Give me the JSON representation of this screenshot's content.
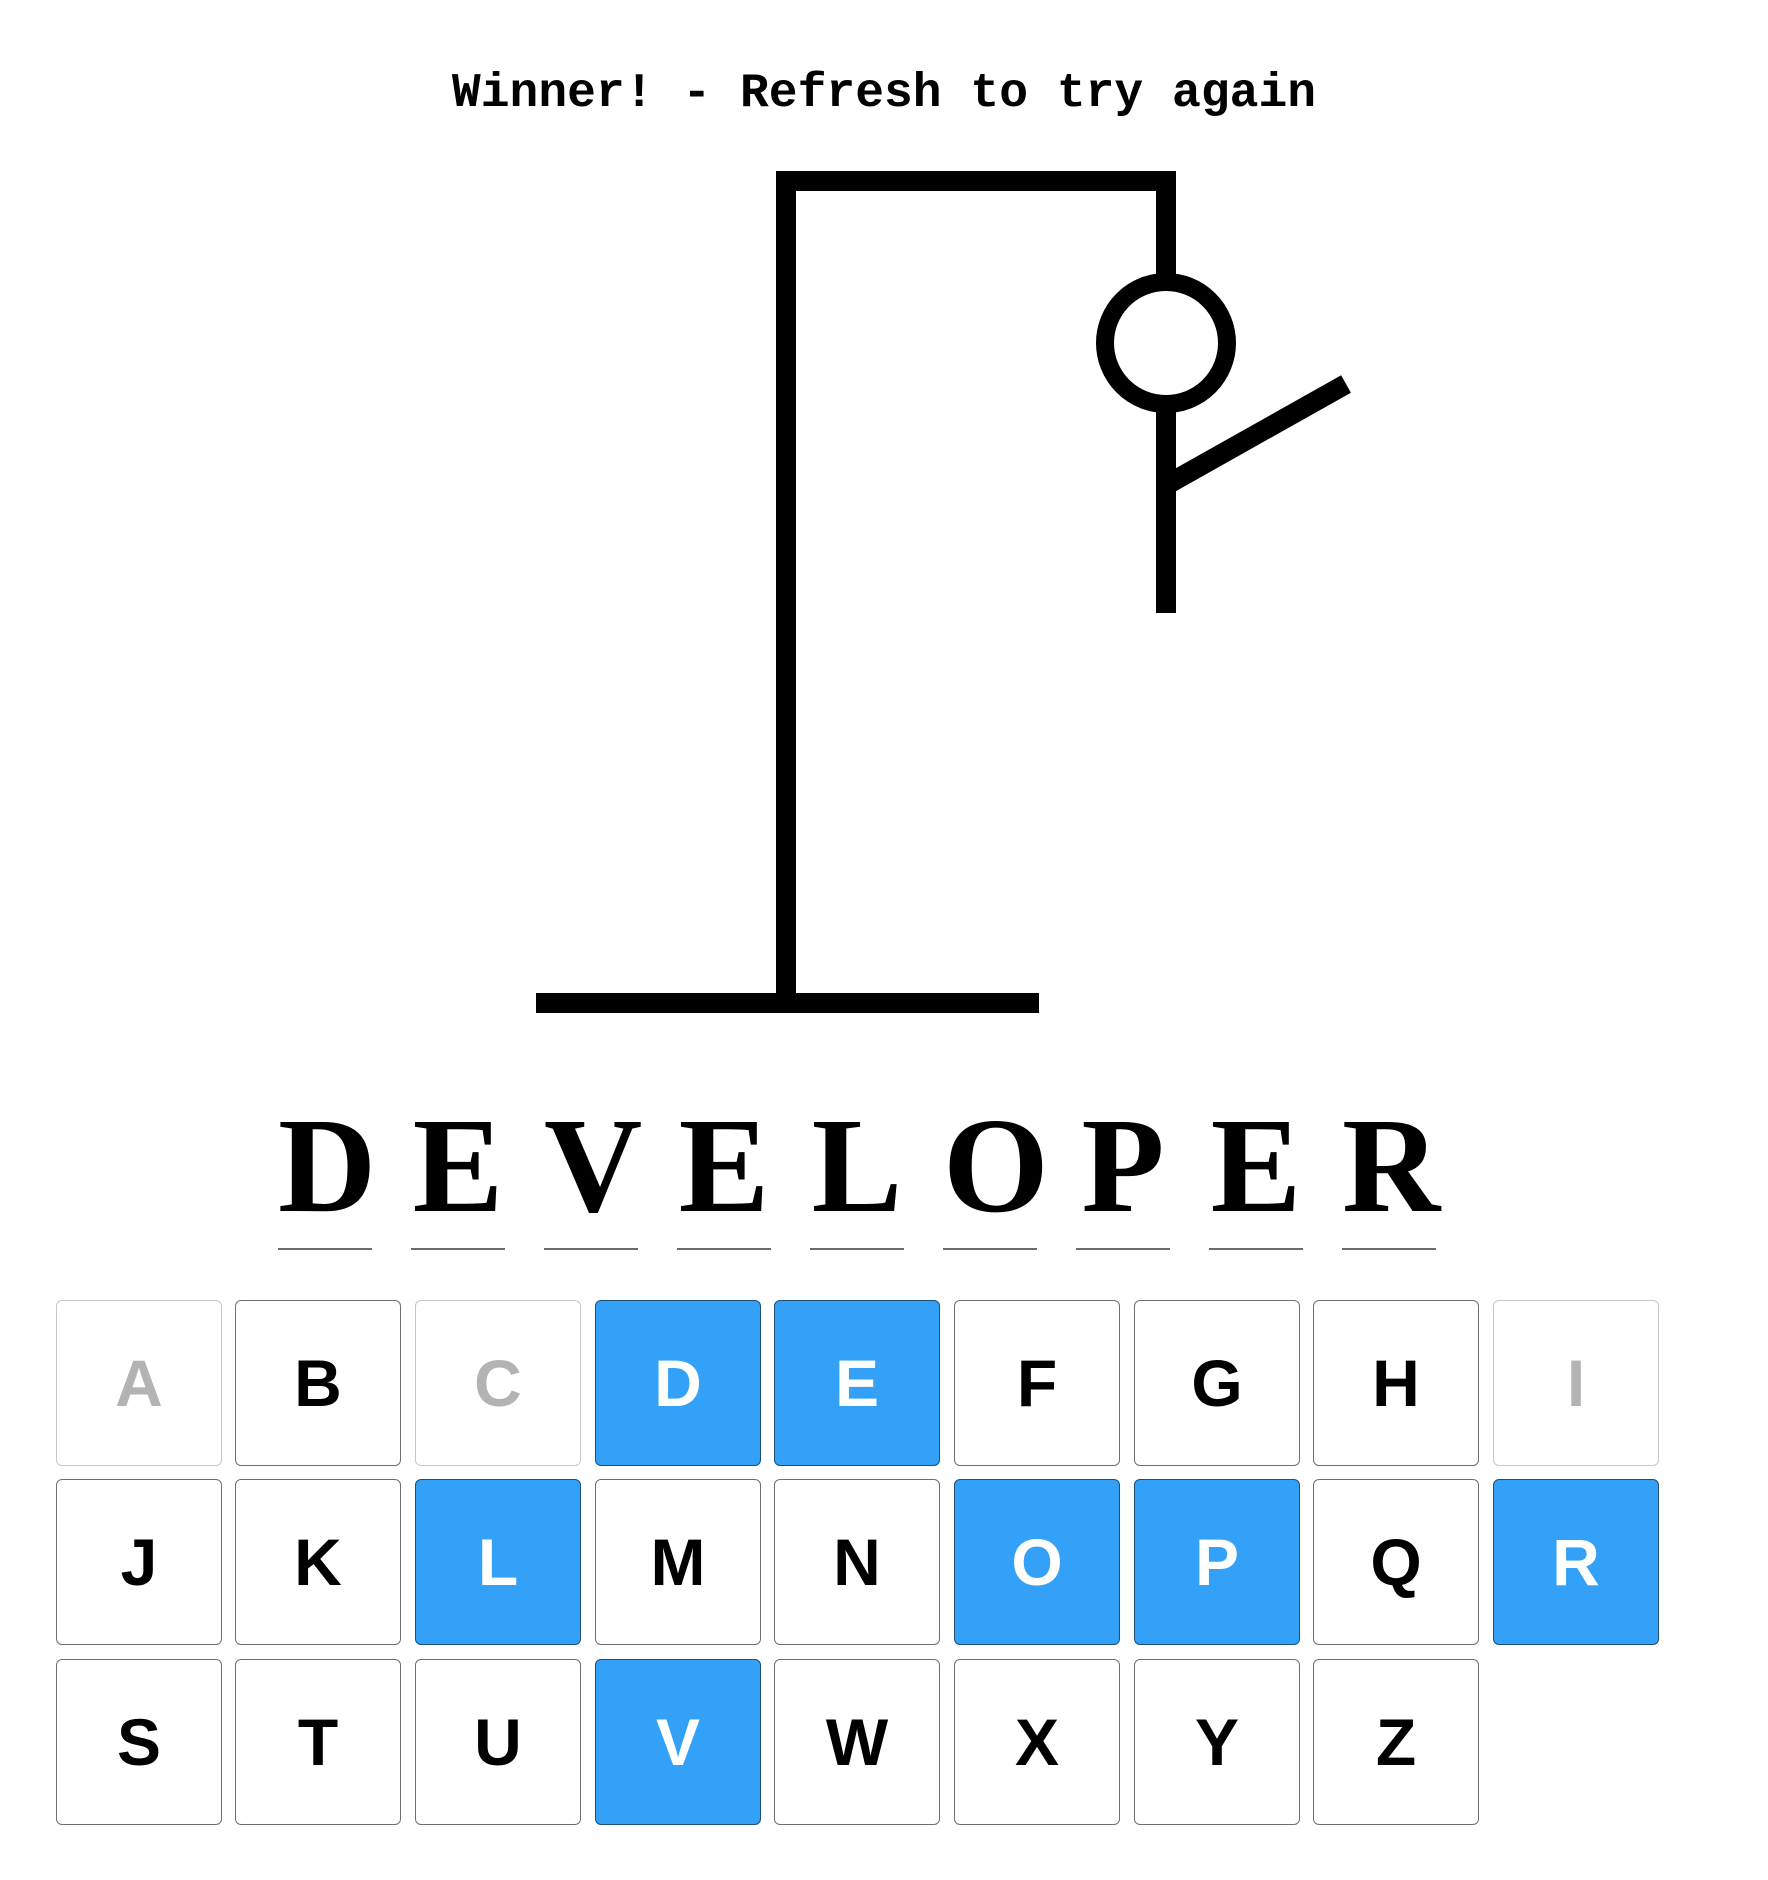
{
  "status": {
    "message": "Winner! - Refresh to try again"
  },
  "hangman": {
    "parts_drawn": [
      "head",
      "body",
      "right-arm"
    ],
    "stroke_color": "#000000"
  },
  "word": {
    "letters": [
      "D",
      "E",
      "V",
      "E",
      "L",
      "O",
      "P",
      "E",
      "R"
    ]
  },
  "keyboard": {
    "keys": [
      {
        "letter": "A",
        "state": "wrong"
      },
      {
        "letter": "B",
        "state": "unused"
      },
      {
        "letter": "C",
        "state": "wrong"
      },
      {
        "letter": "D",
        "state": "correct"
      },
      {
        "letter": "E",
        "state": "correct"
      },
      {
        "letter": "F",
        "state": "unused"
      },
      {
        "letter": "G",
        "state": "unused"
      },
      {
        "letter": "H",
        "state": "unused"
      },
      {
        "letter": "I",
        "state": "wrong"
      },
      {
        "letter": "J",
        "state": "unused"
      },
      {
        "letter": "K",
        "state": "unused"
      },
      {
        "letter": "L",
        "state": "correct"
      },
      {
        "letter": "M",
        "state": "unused"
      },
      {
        "letter": "N",
        "state": "unused"
      },
      {
        "letter": "O",
        "state": "correct"
      },
      {
        "letter": "P",
        "state": "correct"
      },
      {
        "letter": "Q",
        "state": "unused"
      },
      {
        "letter": "R",
        "state": "correct"
      },
      {
        "letter": "S",
        "state": "unused"
      },
      {
        "letter": "T",
        "state": "unused"
      },
      {
        "letter": "U",
        "state": "unused"
      },
      {
        "letter": "V",
        "state": "correct"
      },
      {
        "letter": "W",
        "state": "unused"
      },
      {
        "letter": "X",
        "state": "unused"
      },
      {
        "letter": "Y",
        "state": "unused"
      },
      {
        "letter": "Z",
        "state": "unused"
      }
    ],
    "colors": {
      "correct_bg": "#33a1f7",
      "wrong_text": "#b3b3b3"
    }
  }
}
